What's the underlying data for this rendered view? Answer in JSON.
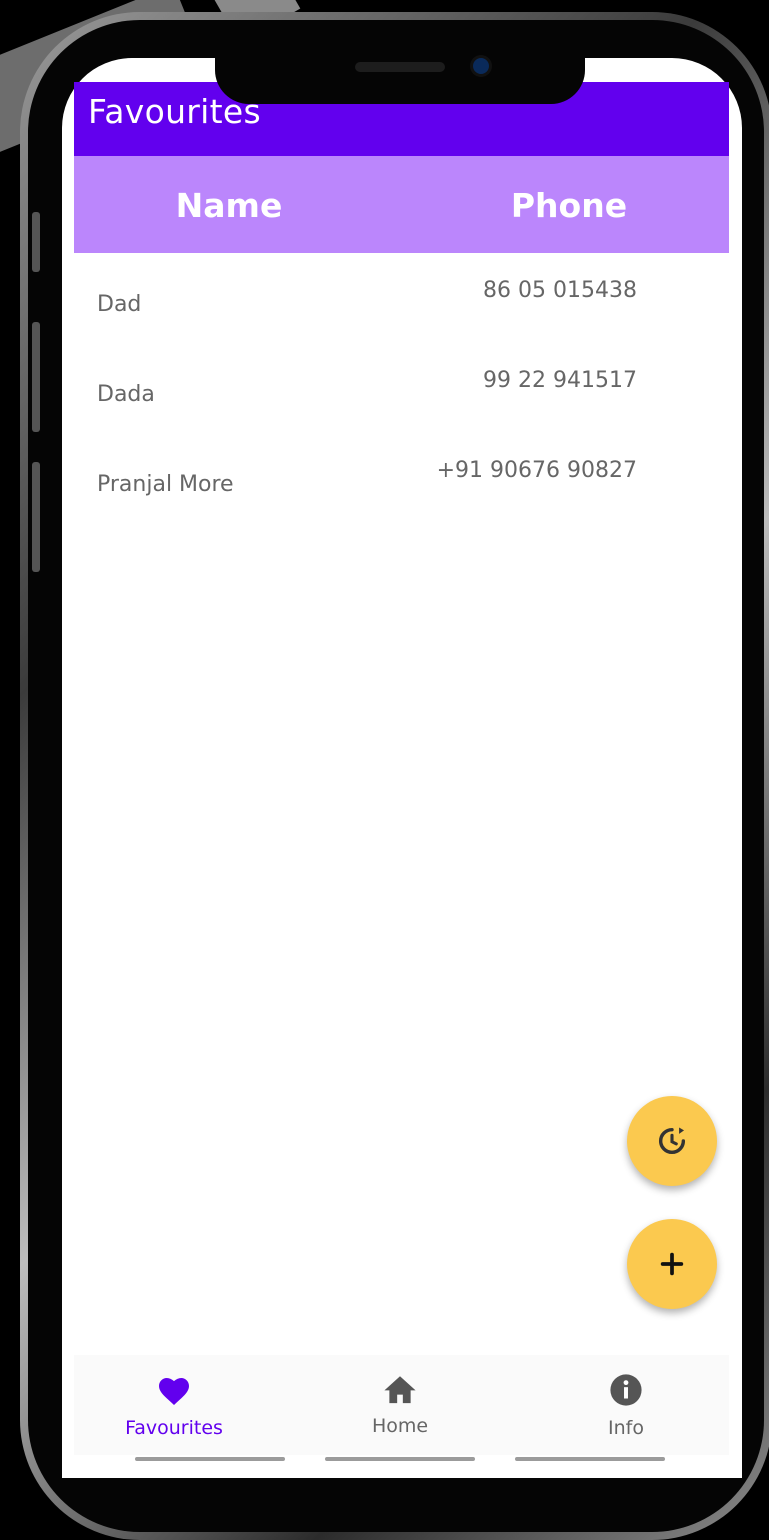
{
  "appbar": {
    "title": "Favourites"
  },
  "table": {
    "headers": {
      "name": "Name",
      "phone": "Phone"
    },
    "rows": [
      {
        "name": "Dad",
        "phone": "86 05 015438"
      },
      {
        "name": "Dada",
        "phone": "99 22 941517"
      },
      {
        "name": "Pranjal More",
        "phone": "+91 90676 90827"
      }
    ]
  },
  "fabs": {
    "history_icon": "history-icon",
    "add_icon": "plus-icon"
  },
  "bottom_nav": {
    "items": [
      {
        "label": "Favourites",
        "icon": "heart-icon",
        "active": true
      },
      {
        "label": "Home",
        "icon": "home-icon",
        "active": false
      },
      {
        "label": "Info",
        "icon": "info-icon",
        "active": false
      }
    ]
  },
  "colors": {
    "primary": "#6200ee",
    "primary_light": "#bb86fc",
    "fab": "#fbc94f"
  }
}
